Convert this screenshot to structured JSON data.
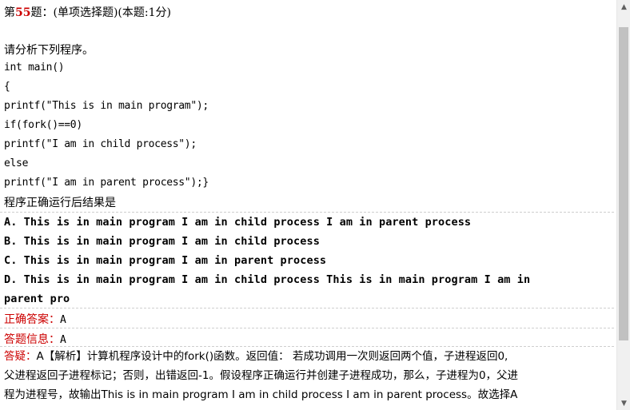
{
  "header": {
    "prefix": "第",
    "number": "55",
    "suffix": "题：(单项选择题)(本题:1分)"
  },
  "question": {
    "intro": "请分析下列程序。",
    "code": [
      "int main()",
      "{",
      "printf(\"This is in main program\");",
      "if(fork()==0)",
      "printf(\"I am in child process\");",
      "else",
      "printf(\"I am in parent process\");}"
    ],
    "prompt": "程序正确运行后结果是"
  },
  "options": [
    "A. This is in main program I am in child process I am in parent process",
    "B. This is in main program I am in child process",
    "C. This is in main program I am in parent process",
    "D. This is in main program I am in child process This is in main program I am in",
    "parent pro"
  ],
  "correct": {
    "label": "正确答案：",
    "value": "A"
  },
  "answer_info": {
    "label": "答题信息：",
    "value": "A"
  },
  "explanation": {
    "label": "答疑：",
    "lines": [
      "A【解析】计算机程序设计中的fork()函数。返回值： 若成功调用一次则返回两个值，子进程返回0,",
      "父进程返回子进程标记；否则，出错返回-1。假设程序正确运行并创建子进程成功，那么，子进程为0，父进",
      "程为进程号，故输出This is in main program I am in child process I am in parent process。故选择A"
    ]
  },
  "scrollbar": {
    "up_icon": "▲",
    "down_icon": "▼"
  }
}
